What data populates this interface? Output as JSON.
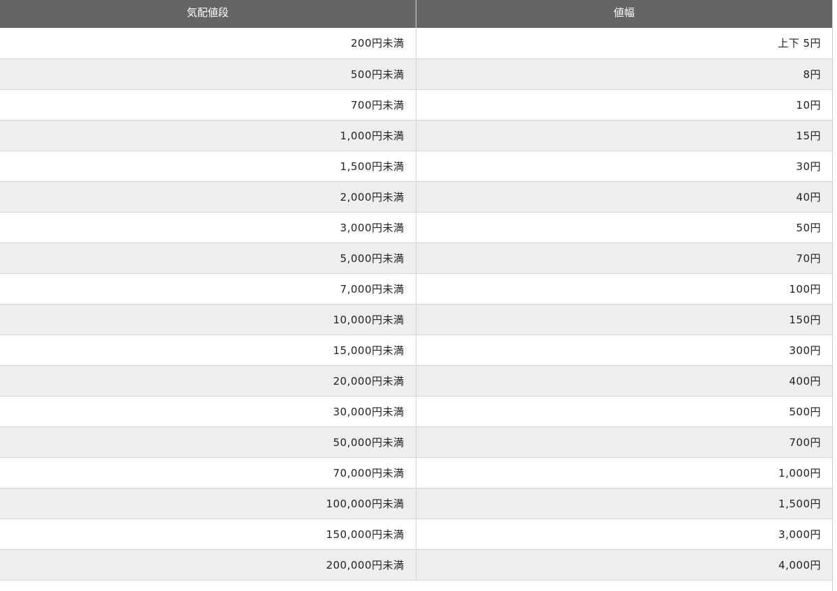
{
  "table": {
    "headers": [
      "気配値段",
      "値幅"
    ],
    "rows": [
      [
        "200円未満",
        "上下 5円"
      ],
      [
        "500円未満",
        "8円"
      ],
      [
        "700円未満",
        "10円"
      ],
      [
        "1,000円未満",
        "15円"
      ],
      [
        "1,500円未満",
        "30円"
      ],
      [
        "2,000円未満",
        "40円"
      ],
      [
        "3,000円未満",
        "50円"
      ],
      [
        "5,000円未満",
        "70円"
      ],
      [
        "7,000円未満",
        "100円"
      ],
      [
        "10,000円未満",
        "150円"
      ],
      [
        "15,000円未満",
        "300円"
      ],
      [
        "20,000円未満",
        "400円"
      ],
      [
        "30,000円未満",
        "500円"
      ],
      [
        "50,000円未満",
        "700円"
      ],
      [
        "70,000円未満",
        "1,000円"
      ],
      [
        "100,000円未満",
        "1,500円"
      ],
      [
        "150,000円未満",
        "3,000円"
      ],
      [
        "200,000円未満",
        "4,000円"
      ]
    ]
  },
  "colors": {
    "header_bg": "#656565",
    "header_text": "#ffffff",
    "row_alt_bg": "#eeeeee",
    "row_bg": "#ffffff",
    "border": "#d6d6d6"
  }
}
